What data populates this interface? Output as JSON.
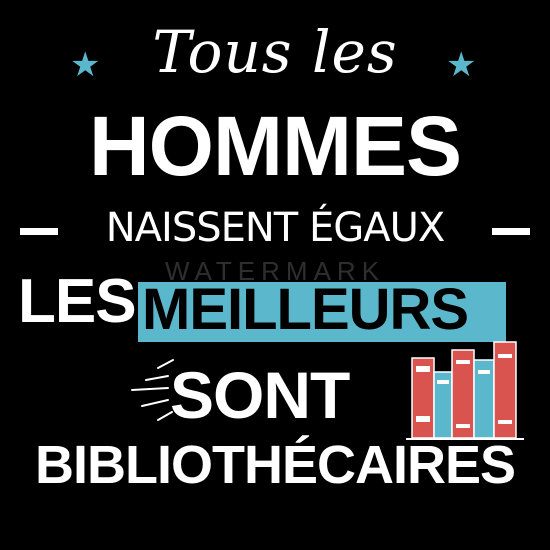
{
  "line1": "Tous les",
  "line2": "HOMMES",
  "line3": "NAISSENT ÉGAUX",
  "line4_left": "LES",
  "line4_right": "MEILLEURS",
  "line5": "SONT",
  "line6": "BIBLIOTHÉCAIRES",
  "watermark": "WATERMARK",
  "colors": {
    "background": "#000000",
    "text": "#ffffff",
    "accent": "#5bb8cc",
    "book_red": "#d9534f"
  },
  "icons": [
    "star-icon",
    "star-icon",
    "books-illustration",
    "sparkle-lines"
  ]
}
